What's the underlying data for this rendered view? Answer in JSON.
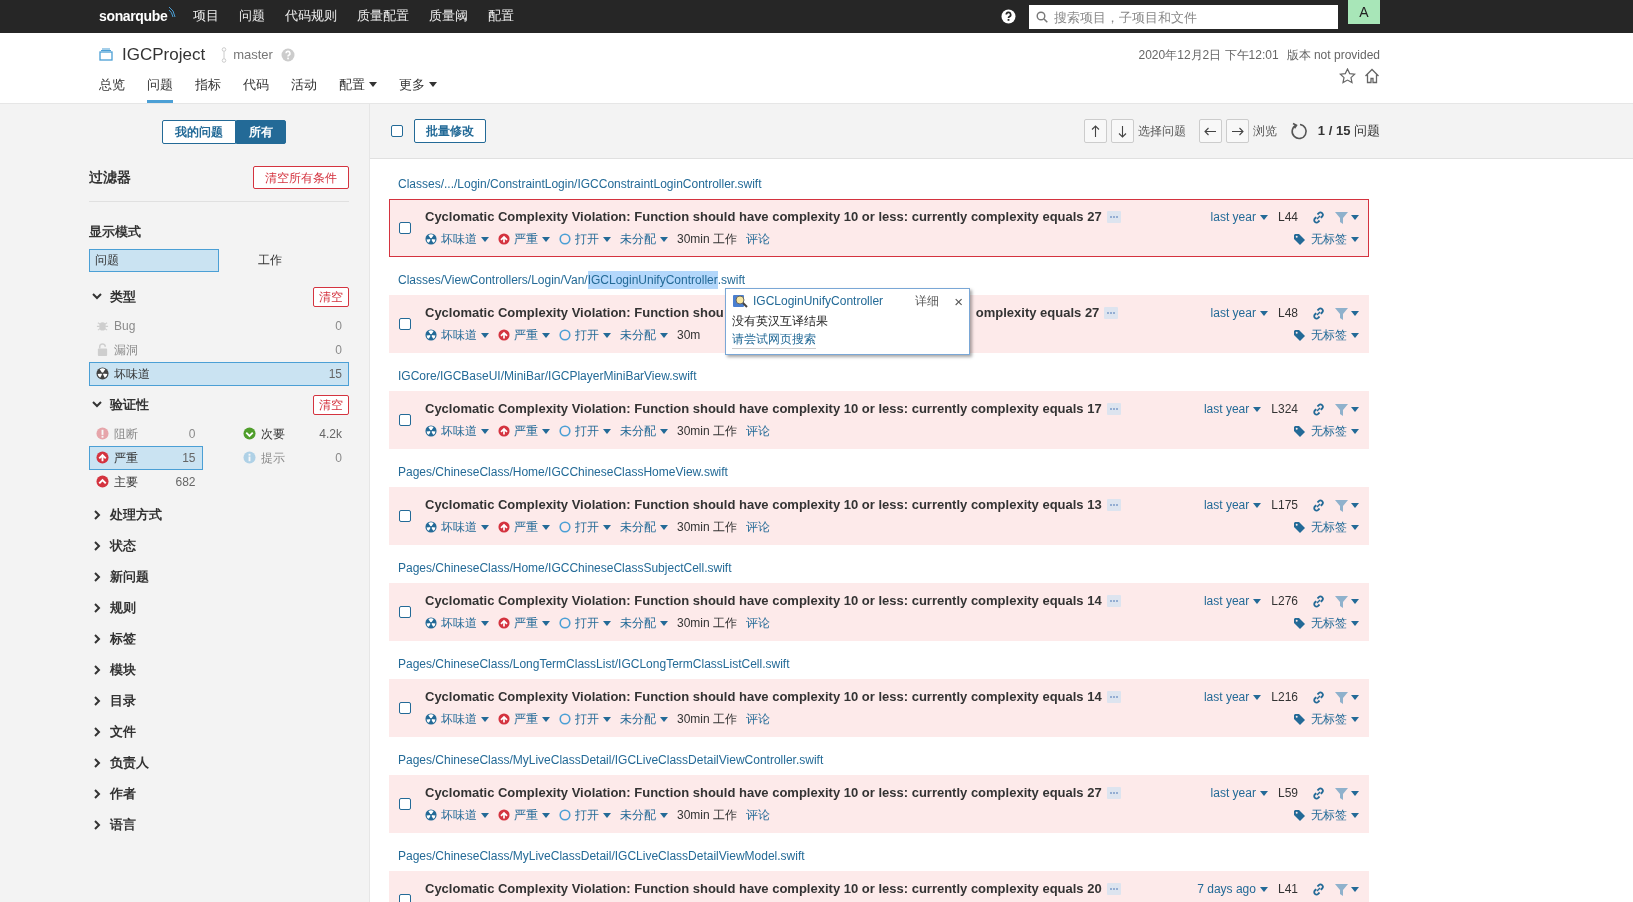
{
  "navbar": {
    "logo": "sonarqube",
    "items": [
      "项目",
      "问题",
      "代码规则",
      "质量配置",
      "质量阈",
      "配置"
    ],
    "search": {
      "placeholder": "搜索项目，子项目和文件"
    },
    "avatar": "A"
  },
  "project": {
    "name": "IGCProject",
    "branch": "master",
    "analysis": "2020年12月2日 下午12:01",
    "version": "版本 not provided",
    "tabs": [
      {
        "label": "总览",
        "selected": false,
        "dropdown": false
      },
      {
        "label": "问题",
        "selected": true,
        "dropdown": false
      },
      {
        "label": "指标",
        "selected": false,
        "dropdown": false
      },
      {
        "label": "代码",
        "selected": false,
        "dropdown": false
      },
      {
        "label": "活动",
        "selected": false,
        "dropdown": false
      },
      {
        "label": "配置",
        "selected": false,
        "dropdown": true
      },
      {
        "label": "更多",
        "selected": false,
        "dropdown": true
      }
    ]
  },
  "sidebar": {
    "scope": [
      {
        "label": "我的问题",
        "selected": false
      },
      {
        "label": "所有",
        "selected": true
      }
    ],
    "filters_title": "过滤器",
    "clear_all": "清空所有条件",
    "mode_title": "显示模式",
    "modes": [
      {
        "label": "问题",
        "selected": true
      },
      {
        "label": "工作",
        "selected": false
      }
    ],
    "facets": [
      {
        "title": "类型",
        "expanded": true,
        "clear": "清空",
        "kind": "list",
        "items": [
          {
            "kind": "bug",
            "label": "Bug",
            "count": "0",
            "selected": false,
            "disabled": true
          },
          {
            "kind": "lock",
            "label": "漏洞",
            "count": "0",
            "selected": false,
            "disabled": true
          },
          {
            "kind": "smell",
            "label": "坏味道",
            "count": "15",
            "selected": true,
            "disabled": false
          }
        ]
      },
      {
        "title": "验证性",
        "expanded": true,
        "clear": "清空",
        "kind": "grid",
        "items": [
          {
            "kind": "blocker",
            "label": "阻断",
            "count": "0",
            "selected": false,
            "disabled": true
          },
          {
            "kind": "minor",
            "label": "次要",
            "count": "4.2k",
            "selected": false,
            "disabled": false
          },
          {
            "kind": "critical",
            "label": "严重",
            "count": "15",
            "selected": true,
            "disabled": false
          },
          {
            "kind": "info",
            "label": "提示",
            "count": "0",
            "selected": false,
            "disabled": true
          },
          {
            "kind": "major",
            "label": "主要",
            "count": "682",
            "selected": false,
            "disabled": false
          }
        ]
      },
      {
        "title": "处理方式",
        "expanded": false
      },
      {
        "title": "状态",
        "expanded": false
      },
      {
        "title": "新问题",
        "expanded": false
      },
      {
        "title": "规则",
        "expanded": false
      },
      {
        "title": "标签",
        "expanded": false
      },
      {
        "title": "模块",
        "expanded": false
      },
      {
        "title": "目录",
        "expanded": false
      },
      {
        "title": "文件",
        "expanded": false
      },
      {
        "title": "负责人",
        "expanded": false
      },
      {
        "title": "作者",
        "expanded": false
      },
      {
        "title": "语言",
        "expanded": false
      }
    ]
  },
  "toolbar": {
    "checked": false,
    "bulk_change": "批量修改",
    "select_label": "选择问题",
    "browse_label": "浏览",
    "counter": "**1 / 15** 问题"
  },
  "issues": [
    {
      "path": [
        {
          "text": "Classes/.../Login/ConstraintLogin/IGCConstraintLoginController.swift",
          "highlighted": false
        }
      ],
      "title": "Cyclomatic Complexity Violation: Function should have complexity 10 or less: currently complexity equals 27",
      "type": "坏味道",
      "severity": "严重",
      "status": "打开",
      "assignee": "未分配",
      "effort": "30min 工作",
      "comment": "评论",
      "date": "last year",
      "line": "L44",
      "tags": "无标签",
      "selected": true,
      "checked": false
    },
    {
      "path": [
        {
          "text": "Classes/ViewControllers/Login/Van/",
          "highlighted": false
        },
        {
          "text": "IGCLoginUnifyController",
          "highlighted": true
        },
        {
          "text": ".swift",
          "highlighted": false
        }
      ],
      "title": "Cyclomatic Complexity Violation: Function shou",
      "title_tail": "omplexity equals 27",
      "type": "坏味道",
      "severity": "严重",
      "status": "打开",
      "assignee": "未分配",
      "effort": "30m",
      "date": "last year",
      "line": "L48",
      "tags": "无标签",
      "selected": false,
      "checked": false
    },
    {
      "path": [
        {
          "text": "IGCore/IGCBaseUI/MiniBar/IGCPlayerMiniBarView.swift",
          "highlighted": false
        }
      ],
      "title": "Cyclomatic Complexity Violation: Function should have complexity 10 or less: currently complexity equals 17",
      "type": "坏味道",
      "severity": "严重",
      "status": "打开",
      "assignee": "未分配",
      "effort": "30min 工作",
      "comment": "评论",
      "date": "last year",
      "line": "L324",
      "tags": "无标签",
      "selected": false,
      "checked": false
    },
    {
      "path": [
        {
          "text": "Pages/ChineseClass/Home/IGCChineseClassHomeView.swift",
          "highlighted": false
        }
      ],
      "title": "Cyclomatic Complexity Violation: Function should have complexity 10 or less: currently complexity equals 13",
      "type": "坏味道",
      "severity": "严重",
      "status": "打开",
      "assignee": "未分配",
      "effort": "30min 工作",
      "comment": "评论",
      "date": "last year",
      "line": "L175",
      "tags": "无标签",
      "selected": false,
      "checked": false
    },
    {
      "path": [
        {
          "text": "Pages/ChineseClass/Home/IGCChineseClassSubjectCell.swift",
          "highlighted": false
        }
      ],
      "title": "Cyclomatic Complexity Violation: Function should have complexity 10 or less: currently complexity equals 14",
      "type": "坏味道",
      "severity": "严重",
      "status": "打开",
      "assignee": "未分配",
      "effort": "30min 工作",
      "comment": "评论",
      "date": "last year",
      "line": "L276",
      "tags": "无标签",
      "selected": false,
      "checked": false
    },
    {
      "path": [
        {
          "text": "Pages/ChineseClass/LongTermClassList/IGCLongTermClassListCell.swift",
          "highlighted": false
        }
      ],
      "title": "Cyclomatic Complexity Violation: Function should have complexity 10 or less: currently complexity equals 14",
      "type": "坏味道",
      "severity": "严重",
      "status": "打开",
      "assignee": "未分配",
      "effort": "30min 工作",
      "comment": "评论",
      "date": "last year",
      "line": "L216",
      "tags": "无标签",
      "selected": false,
      "checked": false
    },
    {
      "path": [
        {
          "text": "Pages/ChineseClass/MyLiveClassDetail/IGCLiveClassDetailViewController.swift",
          "highlighted": false
        }
      ],
      "title": "Cyclomatic Complexity Violation: Function should have complexity 10 or less: currently complexity equals 27",
      "type": "坏味道",
      "severity": "严重",
      "status": "打开",
      "assignee": "未分配",
      "effort": "30min 工作",
      "comment": "评论",
      "date": "last year",
      "line": "L59",
      "tags": "无标签",
      "selected": false,
      "checked": false
    },
    {
      "path": [
        {
          "text": "Pages/ChineseClass/MyLiveClassDetail/IGCLiveClassDetailViewModel.swift",
          "highlighted": false
        }
      ],
      "title": "Cyclomatic Complexity Violation: Function should have complexity 10 or less: currently complexity equals 20",
      "date": "7 days ago",
      "line": "L41",
      "selected": false,
      "checked": false
    }
  ],
  "dictionary_popup": {
    "word": "IGCLoginUnifyController",
    "details": "详细",
    "close": "×",
    "message": "没有英汉互译结果",
    "suggestion": "请尝试网页搜索"
  }
}
